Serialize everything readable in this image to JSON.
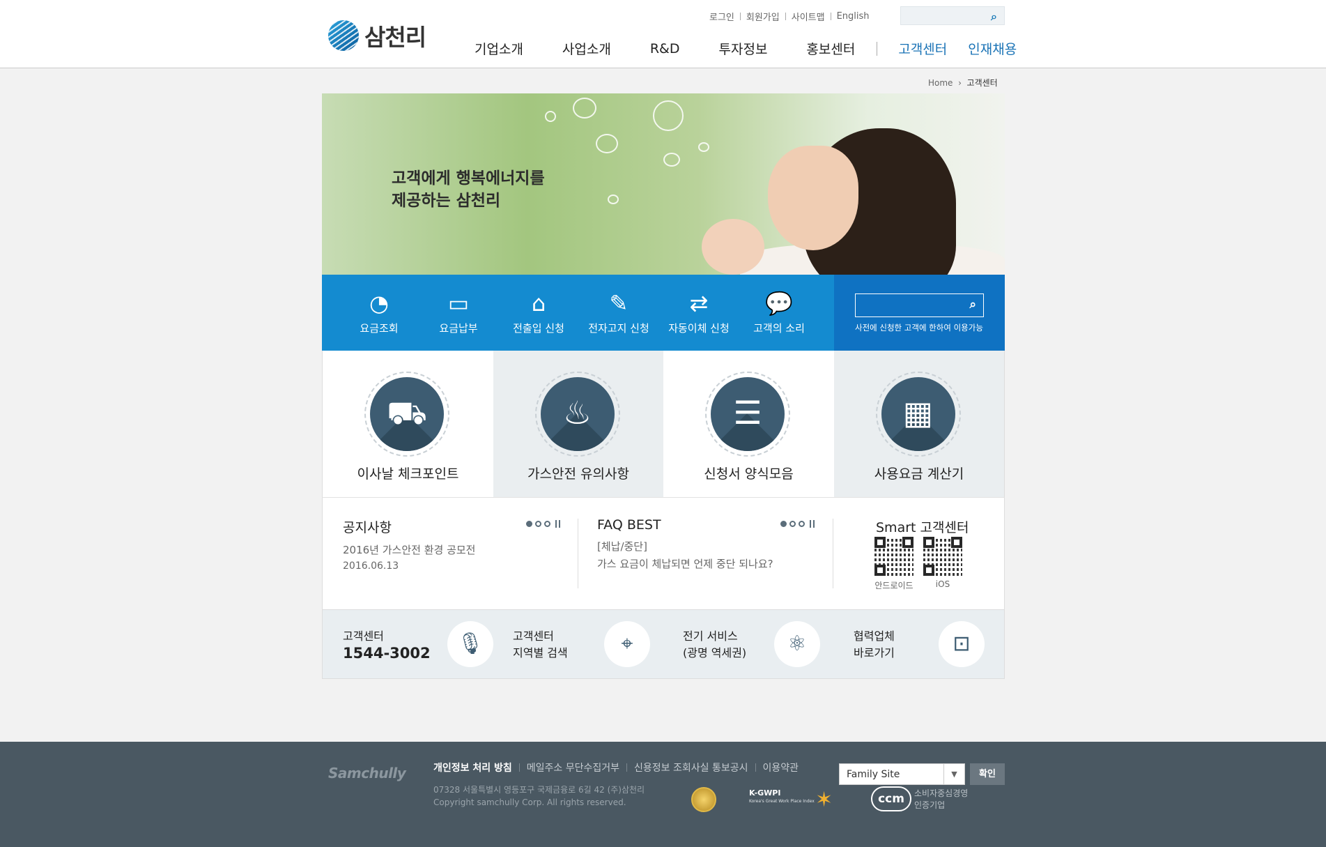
{
  "header": {
    "logo_text": "삼천리",
    "util_links": [
      "로그인",
      "회원가입",
      "사이트맵",
      "English"
    ],
    "nav": [
      "기업소개",
      "사업소개",
      "R&D",
      "투자정보",
      "홍보센터"
    ],
    "nav_right": [
      "고객센터",
      "인재채용"
    ]
  },
  "breadcrumb": {
    "home": "Home",
    "current": "고객센터"
  },
  "hero": {
    "line1": "고객에게 행복에너지를",
    "line2": "제공하는 삼천리"
  },
  "quick": {
    "items": [
      {
        "label": "요금조회",
        "icon": "pie-chart-icon"
      },
      {
        "label": "요금납부",
        "icon": "wallet-icon"
      },
      {
        "label": "전출입 신청",
        "icon": "house-icon"
      },
      {
        "label": "전자고지 신청",
        "icon": "edit-icon"
      },
      {
        "label": "자동이체 신청",
        "icon": "transfer-icon"
      },
      {
        "label": "고객의 소리",
        "icon": "chat-icon"
      }
    ],
    "search_note": "사전에 신청한 고객에 한하여 이용가능"
  },
  "tiles": [
    {
      "label": "이사날 체크포인트",
      "icon": "truck-icon"
    },
    {
      "label": "가스안전 유의사항",
      "icon": "fire-icon"
    },
    {
      "label": "신청서 양식모음",
      "icon": "document-tray-icon"
    },
    {
      "label": "사용요금 계산기",
      "icon": "calculator-icon"
    }
  ],
  "notice": {
    "title": "공지사항",
    "item": "2016년 가스안전 환경 공모전",
    "date": "2016.06.13"
  },
  "faq": {
    "title": "FAQ BEST",
    "category": "[체납/중단]",
    "question": "가스 요금이 체납되면 언제 중단 되나요?"
  },
  "smart": {
    "title": "Smart 고객센터",
    "android": "안드로이드",
    "ios": "iOS"
  },
  "contact": {
    "center_label": "고객센터",
    "phone": "1544-3002",
    "region_line1": "고객센터",
    "region_line2": "지역별 검색",
    "elec_line1": "전기 서비스",
    "elec_line2": "(광명 역세권)",
    "partner_line1": "협력업체",
    "partner_line2": "바로가기"
  },
  "footer": {
    "logo": "Samchully",
    "links": [
      "개인정보 처리 방침",
      "메일주소 무단수집거부",
      "신용정보 조회사실 통보공시",
      "이용약관"
    ],
    "address": "07328 서울특별시 영등포구 국제금융로 6길 42 (주)삼천리",
    "copyright": "Copyright samchully Corp. All rights reserved.",
    "family_site": "Family Site",
    "confirm": "확인",
    "kgwpi": "K-GWPI",
    "kgwpi_sub": "Korea's Great Work Place Index",
    "ccm": "ccm",
    "ccm_text1": "소비자중심경영",
    "ccm_text2": "인증기업"
  }
}
